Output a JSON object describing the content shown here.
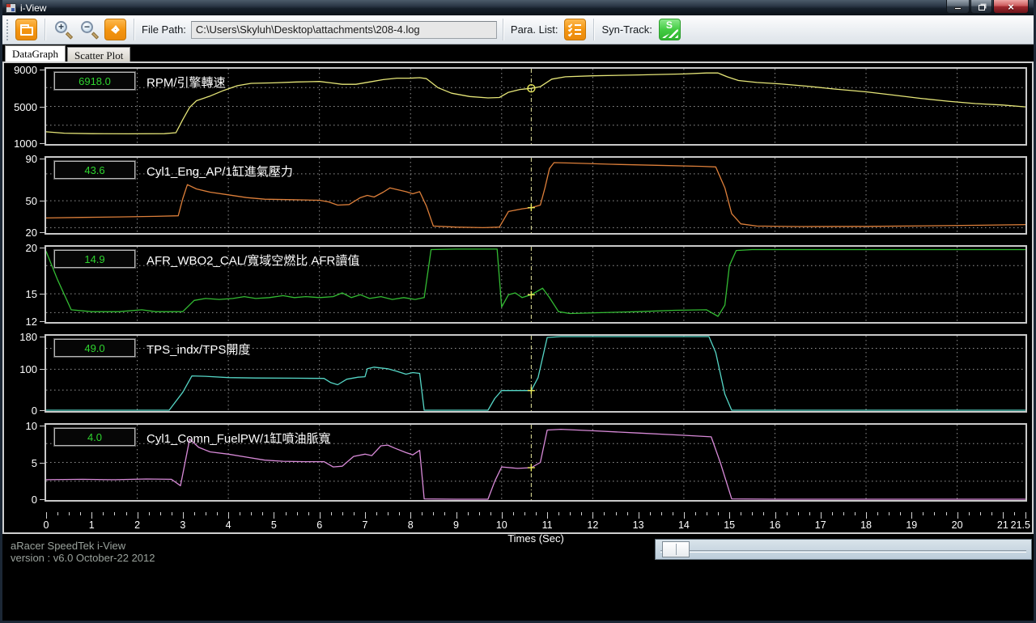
{
  "window": {
    "title": "i-View",
    "controls": {
      "minimize": "minimize",
      "maximize": "restore",
      "close": "close"
    }
  },
  "toolbar": {
    "open_icon": "folder-open",
    "zoom_in_icon": "magnifier-plus",
    "zoom_out_icon": "magnifier-minus",
    "pan_icon": "four-way-arrows",
    "file_path_label": "File Path:",
    "file_path_value": "C:\\Users\\Skyluh\\Desktop\\attachments\\208-4.log",
    "para_list_label": "Para. List:",
    "para_list_icon": "checklist",
    "syn_track_label": "Syn-Track:",
    "syn_track_icon": "s-track"
  },
  "tabs": [
    {
      "label": "DataGraph",
      "active": true
    },
    {
      "label": "Scatter Plot",
      "active": false
    }
  ],
  "status": {
    "line1": "aRacer SpeedTek i-View",
    "line2": "version : v6.0  October-22 2012"
  },
  "chart_data": {
    "type": "line",
    "xlabel": "Times (Sec)",
    "x_range": [
      0,
      21.5
    ],
    "x_major_tick_step": 1,
    "x_minor_tick_step": 0.25,
    "x_last_tick_label": "21.5",
    "grid": "dashed",
    "grid_times_sec": [
      2,
      4,
      6,
      8,
      10,
      12,
      14,
      16,
      18,
      20
    ],
    "cursor_time_sec": 10.65,
    "cursor_color": "#e9e9a0",
    "marker_color": "#e8e85a",
    "panels": [
      {
        "id": "rpm",
        "label": "RPM/引擎轉速",
        "value": "6918.0",
        "color": "#e6e678",
        "y_min": 1000,
        "y_max": 9000,
        "y_ticks": [
          9000,
          5000,
          1000
        ],
        "gridline_values": [
          7000,
          5000,
          3000
        ],
        "cursor_value": 6918,
        "marker": "circle",
        "series": [
          [
            0,
            2300
          ],
          [
            0.4,
            2150
          ],
          [
            1,
            2100
          ],
          [
            1.8,
            2080
          ],
          [
            2.6,
            2100
          ],
          [
            2.85,
            2200
          ],
          [
            3.0,
            3600
          ],
          [
            3.15,
            4900
          ],
          [
            3.3,
            5600
          ],
          [
            3.6,
            6100
          ],
          [
            3.9,
            6700
          ],
          [
            4.2,
            7200
          ],
          [
            4.5,
            7450
          ],
          [
            5,
            7500
          ],
          [
            5.5,
            7600
          ],
          [
            6,
            7650
          ],
          [
            6.25,
            7500
          ],
          [
            6.5,
            7350
          ],
          [
            6.8,
            7350
          ],
          [
            7.1,
            7600
          ],
          [
            7.4,
            7850
          ],
          [
            7.7,
            8000
          ],
          [
            8,
            8000
          ],
          [
            8.2,
            8050
          ],
          [
            8.35,
            7950
          ],
          [
            8.6,
            7000
          ],
          [
            8.9,
            6400
          ],
          [
            9.3,
            6050
          ],
          [
            9.7,
            5900
          ],
          [
            9.95,
            5950
          ],
          [
            10.15,
            6500
          ],
          [
            10.4,
            6800
          ],
          [
            10.65,
            6918
          ],
          [
            10.85,
            7100
          ],
          [
            11.1,
            7900
          ],
          [
            11.4,
            8150
          ],
          [
            12,
            8250
          ],
          [
            13,
            8350
          ],
          [
            14,
            8450
          ],
          [
            14.5,
            8550
          ],
          [
            14.75,
            8550
          ],
          [
            14.95,
            8150
          ],
          [
            15.2,
            7750
          ],
          [
            15.6,
            7550
          ],
          [
            16.1,
            7400
          ],
          [
            16.7,
            7150
          ],
          [
            17.3,
            6850
          ],
          [
            18,
            6550
          ],
          [
            18.6,
            6200
          ],
          [
            19.2,
            5850
          ],
          [
            19.8,
            5550
          ],
          [
            20.4,
            5300
          ],
          [
            21,
            5150
          ],
          [
            21.5,
            4950
          ]
        ]
      },
      {
        "id": "ap",
        "label": "Cyl1_Eng_AP/1缸進氣壓力",
        "value": "43.6",
        "color": "#dd7f3a",
        "y_min": 20,
        "y_max": 90,
        "y_ticks": [
          90,
          50,
          20
        ],
        "gridline_values": [
          75,
          50,
          25
        ],
        "cursor_value": 43.6,
        "marker": "plus",
        "series": [
          [
            0,
            34
          ],
          [
            0.8,
            34.5
          ],
          [
            1.6,
            35
          ],
          [
            2.4,
            35.5
          ],
          [
            2.9,
            36
          ],
          [
            3.0,
            52
          ],
          [
            3.1,
            65
          ],
          [
            3.3,
            61
          ],
          [
            3.6,
            58
          ],
          [
            4,
            55.5
          ],
          [
            4.4,
            53
          ],
          [
            4.8,
            51.5
          ],
          [
            5.4,
            51
          ],
          [
            6,
            50.5
          ],
          [
            6.2,
            49
          ],
          [
            6.4,
            46
          ],
          [
            6.65,
            46.5
          ],
          [
            6.9,
            53
          ],
          [
            7.05,
            55
          ],
          [
            7.2,
            53.5
          ],
          [
            7.4,
            58
          ],
          [
            7.55,
            62
          ],
          [
            7.7,
            60.5
          ],
          [
            7.9,
            58.5
          ],
          [
            8.05,
            56.5
          ],
          [
            8.2,
            58.5
          ],
          [
            8.35,
            45
          ],
          [
            8.5,
            26.5
          ],
          [
            9,
            25.5
          ],
          [
            9.6,
            25
          ],
          [
            9.95,
            25.5
          ],
          [
            10.15,
            40
          ],
          [
            10.45,
            42.5
          ],
          [
            10.65,
            43.6
          ],
          [
            10.85,
            46
          ],
          [
            10.95,
            62
          ],
          [
            11.05,
            80
          ],
          [
            11.15,
            85.5
          ],
          [
            11.6,
            85
          ],
          [
            12.4,
            84
          ],
          [
            13.4,
            83
          ],
          [
            14.4,
            82
          ],
          [
            14.7,
            81.5
          ],
          [
            14.9,
            62
          ],
          [
            15.05,
            38
          ],
          [
            15.25,
            28.5
          ],
          [
            15.6,
            26.5
          ],
          [
            16.5,
            26
          ],
          [
            18,
            26.2
          ],
          [
            19.5,
            26.8
          ],
          [
            20.5,
            27.2
          ],
          [
            21.5,
            27.8
          ]
        ]
      },
      {
        "id": "afr",
        "label": "AFR_WBO2_CAL/寬域空燃比 AFR讀值",
        "value": "14.9",
        "color": "#33bb33",
        "y_min": 12,
        "y_max": 20,
        "y_ticks": [
          20,
          15,
          12
        ],
        "gridline_values": [
          18,
          15,
          13
        ],
        "cursor_value": 14.9,
        "marker": "plus",
        "series": [
          [
            0,
            19.5
          ],
          [
            0.25,
            16.5
          ],
          [
            0.55,
            13.3
          ],
          [
            1,
            13.1
          ],
          [
            1.6,
            13.1
          ],
          [
            2.1,
            13.3
          ],
          [
            2.4,
            13.1
          ],
          [
            3,
            13.1
          ],
          [
            3.25,
            14.3
          ],
          [
            3.5,
            14.5
          ],
          [
            3.8,
            14.4
          ],
          [
            4.1,
            14.5
          ],
          [
            4.35,
            14.7
          ],
          [
            4.6,
            14.5
          ],
          [
            4.9,
            14.6
          ],
          [
            5.2,
            14.8
          ],
          [
            5.45,
            14.6
          ],
          [
            5.7,
            14.7
          ],
          [
            6,
            14.6
          ],
          [
            6.3,
            14.7
          ],
          [
            6.5,
            15.1
          ],
          [
            6.7,
            14.6
          ],
          [
            6.9,
            14.9
          ],
          [
            7.1,
            14.5
          ],
          [
            7.35,
            14.7
          ],
          [
            7.6,
            14.4
          ],
          [
            7.85,
            14.6
          ],
          [
            8.1,
            14.4
          ],
          [
            8.3,
            14.6
          ],
          [
            8.45,
            19.7
          ],
          [
            9,
            19.75
          ],
          [
            9.6,
            19.75
          ],
          [
            9.9,
            19.75
          ],
          [
            10.0,
            13.6
          ],
          [
            10.15,
            14.9
          ],
          [
            10.3,
            15.1
          ],
          [
            10.45,
            14.6
          ],
          [
            10.65,
            14.9
          ],
          [
            10.9,
            15.6
          ],
          [
            11.05,
            14.6
          ],
          [
            11.25,
            13.1
          ],
          [
            11.5,
            12.9
          ],
          [
            12.2,
            13
          ],
          [
            13,
            13.1
          ],
          [
            13.8,
            13.25
          ],
          [
            14.5,
            13.3
          ],
          [
            14.75,
            12.6
          ],
          [
            14.9,
            13.8
          ],
          [
            15.0,
            18
          ],
          [
            15.15,
            19.6
          ],
          [
            15.5,
            19.7
          ],
          [
            17,
            19.7
          ],
          [
            19,
            19.7
          ],
          [
            21.5,
            19.7
          ]
        ]
      },
      {
        "id": "tps",
        "label": "TPS_indx/TPS開度",
        "value": "49.0",
        "color": "#55d6c6",
        "y_min": 0,
        "y_max": 180,
        "y_ticks": [
          180,
          100,
          0
        ],
        "gridline_values": [
          150,
          100,
          50
        ],
        "cursor_value": 49,
        "marker": "plus",
        "series": [
          [
            0,
            1
          ],
          [
            2.7,
            1
          ],
          [
            3.0,
            45
          ],
          [
            3.2,
            84
          ],
          [
            3.5,
            83
          ],
          [
            4,
            80
          ],
          [
            4.6,
            79
          ],
          [
            5.4,
            78.5
          ],
          [
            6.1,
            78
          ],
          [
            6.25,
            68
          ],
          [
            6.4,
            63
          ],
          [
            6.6,
            76
          ],
          [
            6.85,
            81
          ],
          [
            7.0,
            82
          ],
          [
            7.05,
            101
          ],
          [
            7.2,
            105
          ],
          [
            7.5,
            101
          ],
          [
            7.7,
            95
          ],
          [
            7.9,
            88
          ],
          [
            8.05,
            92
          ],
          [
            8.2,
            90
          ],
          [
            8.3,
            2
          ],
          [
            8.5,
            1
          ],
          [
            9.7,
            1
          ],
          [
            9.85,
            30
          ],
          [
            10.0,
            49
          ],
          [
            10.65,
            49
          ],
          [
            10.8,
            80
          ],
          [
            11.0,
            176
          ],
          [
            11.3,
            178
          ],
          [
            14.55,
            178
          ],
          [
            14.7,
            140
          ],
          [
            14.9,
            40
          ],
          [
            15.05,
            1
          ],
          [
            16,
            1
          ],
          [
            18,
            1
          ],
          [
            21.5,
            1
          ]
        ]
      },
      {
        "id": "fuelpw",
        "label": "Cyl1_Comn_FuelPW/1缸噴油脈寬",
        "value": "4.0",
        "color": "#d88ad8",
        "y_min": 0,
        "y_max": 10,
        "y_ticks": [
          10,
          5,
          0
        ],
        "gridline_values": [
          7.5,
          5,
          2.5
        ],
        "cursor_value": 4.3,
        "marker": "plus",
        "series": [
          [
            0,
            2.7
          ],
          [
            0.8,
            2.75
          ],
          [
            1.5,
            2.7
          ],
          [
            2.2,
            2.8
          ],
          [
            2.75,
            2.75
          ],
          [
            2.95,
            1.9
          ],
          [
            3.05,
            5
          ],
          [
            3.15,
            8.1
          ],
          [
            3.35,
            7
          ],
          [
            3.6,
            6.4
          ],
          [
            4,
            6.1
          ],
          [
            4.4,
            5.7
          ],
          [
            4.8,
            5.3
          ],
          [
            5.2,
            5.15
          ],
          [
            5.7,
            5.1
          ],
          [
            6.1,
            5.1
          ],
          [
            6.3,
            4.4
          ],
          [
            6.5,
            4.5
          ],
          [
            6.75,
            5.8
          ],
          [
            7,
            6.1
          ],
          [
            7.15,
            5.9
          ],
          [
            7.35,
            7.2
          ],
          [
            7.5,
            7.3
          ],
          [
            7.65,
            6.9
          ],
          [
            7.9,
            6.3
          ],
          [
            8.05,
            6
          ],
          [
            8.2,
            6.6
          ],
          [
            8.3,
            0.15
          ],
          [
            9,
            0.1
          ],
          [
            9.7,
            0.1
          ],
          [
            9.85,
            2.5
          ],
          [
            10.0,
            4.4
          ],
          [
            10.35,
            4.2
          ],
          [
            10.65,
            4.3
          ],
          [
            10.85,
            5
          ],
          [
            11.0,
            9.3
          ],
          [
            11.3,
            9.4
          ],
          [
            12,
            9.2
          ],
          [
            13,
            8.9
          ],
          [
            14,
            8.6
          ],
          [
            14.6,
            8.4
          ],
          [
            14.8,
            5
          ],
          [
            15.05,
            0.15
          ],
          [
            16,
            0.1
          ],
          [
            18,
            0.1
          ],
          [
            21.5,
            0.1
          ]
        ]
      }
    ]
  }
}
